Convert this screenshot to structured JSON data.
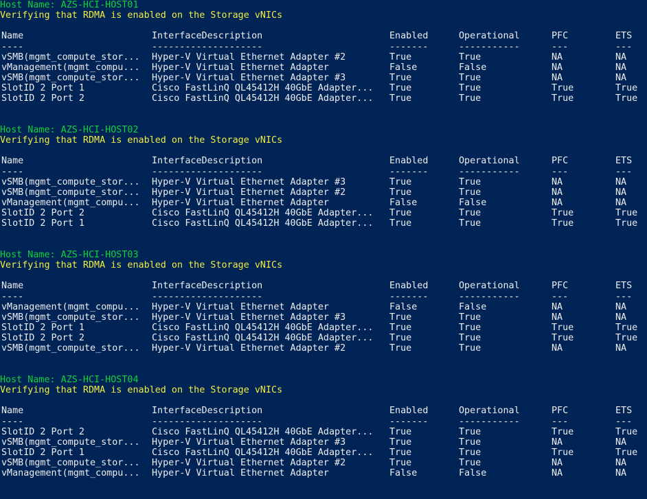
{
  "colors": {
    "background": "#012456",
    "text": "#eeedf0",
    "host_line": "#13d13a",
    "verify_line": "#f2ed43"
  },
  "headers": [
    "Name",
    "InterfaceDescription",
    "Enabled",
    "Operational",
    "PFC",
    "ETS"
  ],
  "underlines": [
    "----",
    "--------------------",
    "-------",
    "-----------",
    "---",
    "---"
  ],
  "hosts": [
    {
      "host_line": "Host Name: AZS-HCI-HOST01",
      "verify_line": "Verifying that RDMA is enabled on the Storage vNICs",
      "rows": [
        [
          "vSMB(mgmt_compute_stor...",
          "Hyper-V Virtual Ethernet Adapter #2",
          "True",
          "True",
          "NA",
          "NA"
        ],
        [
          "vManagement(mgmt_compu...",
          "Hyper-V Virtual Ethernet Adapter",
          "False",
          "False",
          "NA",
          "NA"
        ],
        [
          "vSMB(mgmt_compute_stor...",
          "Hyper-V Virtual Ethernet Adapter #3",
          "True",
          "True",
          "NA",
          "NA"
        ],
        [
          "SlotID 2 Port 1",
          "Cisco FastLinQ QL45412H 40GbE Adapter...",
          "True",
          "True",
          "True",
          "True"
        ],
        [
          "SlotID 2 Port 2",
          "Cisco FastLinQ QL45412H 40GbE Adapter...",
          "True",
          "True",
          "True",
          "True"
        ]
      ]
    },
    {
      "host_line": "Host Name: AZS-HCI-HOST02",
      "verify_line": "Verifying that RDMA is enabled on the Storage vNICs",
      "rows": [
        [
          "vSMB(mgmt_compute_stor...",
          "Hyper-V Virtual Ethernet Adapter #3",
          "True",
          "True",
          "NA",
          "NA"
        ],
        [
          "vSMB(mgmt_compute_stor...",
          "Hyper-V Virtual Ethernet Adapter #2",
          "True",
          "True",
          "NA",
          "NA"
        ],
        [
          "vManagement(mgmt_compu...",
          "Hyper-V Virtual Ethernet Adapter",
          "False",
          "False",
          "NA",
          "NA"
        ],
        [
          "SlotID 2 Port 2",
          "Cisco FastLinQ QL45412H 40GbE Adapter...",
          "True",
          "True",
          "True",
          "True"
        ],
        [
          "SlotID 2 Port 1",
          "Cisco FastLinQ QL45412H 40GbE Adapter...",
          "True",
          "True",
          "True",
          "True"
        ]
      ]
    },
    {
      "host_line": "Host Name: AZS-HCI-HOST03",
      "verify_line": "Verifying that RDMA is enabled on the Storage vNICs",
      "rows": [
        [
          "vManagement(mgmt_compu...",
          "Hyper-V Virtual Ethernet Adapter",
          "False",
          "False",
          "NA",
          "NA"
        ],
        [
          "vSMB(mgmt_compute_stor...",
          "Hyper-V Virtual Ethernet Adapter #3",
          "True",
          "True",
          "NA",
          "NA"
        ],
        [
          "SlotID 2 Port 1",
          "Cisco FastLinQ QL45412H 40GbE Adapter...",
          "True",
          "True",
          "True",
          "True"
        ],
        [
          "SlotID 2 Port 2",
          "Cisco FastLinQ QL45412H 40GbE Adapter...",
          "True",
          "True",
          "True",
          "True"
        ],
        [
          "vSMB(mgmt_compute_stor...",
          "Hyper-V Virtual Ethernet Adapter #2",
          "True",
          "True",
          "NA",
          "NA"
        ]
      ]
    },
    {
      "host_line": "Host Name: AZS-HCI-HOST04",
      "verify_line": "Verifying that RDMA is enabled on the Storage vNICs",
      "rows": [
        [
          "SlotID 2 Port 2",
          "Cisco FastLinQ QL45412H 40GbE Adapter...",
          "True",
          "True",
          "True",
          "True"
        ],
        [
          "vSMB(mgmt_compute_stor...",
          "Hyper-V Virtual Ethernet Adapter #3",
          "True",
          "True",
          "NA",
          "NA"
        ],
        [
          "SlotID 2 Port 1",
          "Cisco FastLinQ QL45412H 40GbE Adapter...",
          "True",
          "True",
          "True",
          "True"
        ],
        [
          "vSMB(mgmt_compute_stor...",
          "Hyper-V Virtual Ethernet Adapter #2",
          "True",
          "True",
          "NA",
          "NA"
        ],
        [
          "vManagement(mgmt_compu...",
          "Hyper-V Virtual Ethernet Adapter",
          "False",
          "False",
          "NA",
          "NA"
        ]
      ]
    }
  ]
}
